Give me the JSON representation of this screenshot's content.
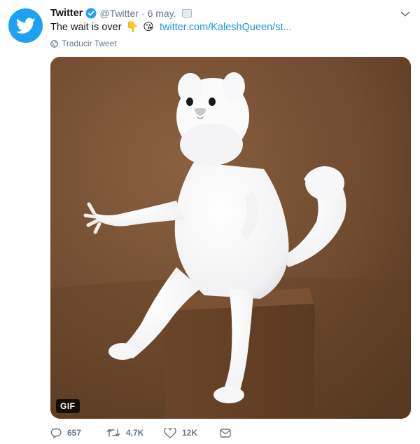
{
  "tweet": {
    "name": "Twitter",
    "handle": "@Twitter",
    "separator": "·",
    "date": "6 may.",
    "text": "The wait is over",
    "emoji_1": "👇",
    "emoji_2": "😘",
    "link": "twitter.com/KaleshQueen/st...",
    "translate": "Traducir Tweet"
  },
  "media": {
    "badge": "GIF"
  },
  "actions": {
    "replies": "657",
    "retweets": "4,7K",
    "likes": "12K"
  },
  "colors": {
    "brand": "#1da1f2",
    "link": "#1b95e0",
    "muted": "#657786"
  },
  "icons": [
    "twitter-bird-icon",
    "verified-badge-icon",
    "chevron-down-icon",
    "globe-icon",
    "reply-icon",
    "retweet-icon",
    "like-icon",
    "direct-message-icon"
  ]
}
